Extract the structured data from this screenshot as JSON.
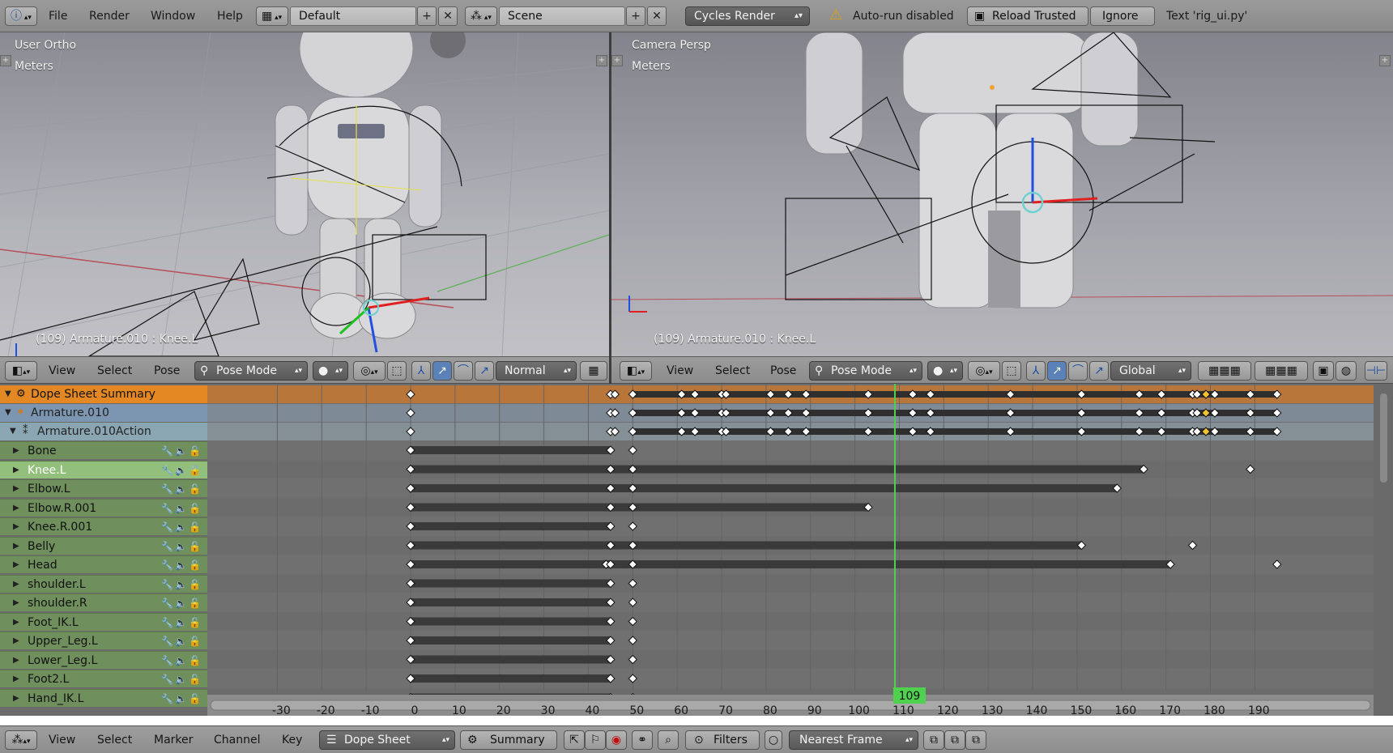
{
  "colors": {
    "summary_row": "#e38822",
    "object_row": "#7c95b1",
    "action_row": "#8aa6b3",
    "group_row": "#6f8f5c",
    "group_row_selected": "#92c07c",
    "playhead": "#4fd14f",
    "keyframe": "#ffffff",
    "keyframe_selected": "#f5c42c"
  },
  "topbar": {
    "info_icon": "info-icon",
    "menus": [
      "File",
      "Render",
      "Window",
      "Help"
    ],
    "layout_name": "Default",
    "scene_name": "Scene",
    "render_engine": "Cycles Render",
    "warning_text": "Auto-run disabled",
    "reload_label": "Reload Trusted",
    "ignore_label": "Ignore",
    "script_text": "Text 'rig_ui.py'"
  },
  "viewport_left": {
    "view_label": "User Ortho",
    "units_label": "Meters",
    "status": "(109) Armature.010 : Knee.L"
  },
  "viewport_right": {
    "view_label": "Camera Persp",
    "units_label": "Meters",
    "status": "(109) Armature.010 : Knee.L"
  },
  "viewport_header_left": {
    "menus": [
      "View",
      "Select",
      "Pose"
    ],
    "mode": "Pose Mode",
    "orientation": "Normal"
  },
  "viewport_header_right": {
    "menus": [
      "View",
      "Select",
      "Pose"
    ],
    "mode": "Pose Mode",
    "orientation": "Global"
  },
  "dopesheet": {
    "summary_label": "Dope Sheet Summary",
    "object_label": "Armature.010",
    "action_label": "Armature.010Action",
    "channels": [
      "Bone",
      "Knee.L",
      "Elbow.L",
      "Elbow.R.001",
      "Knee.R.001",
      "Belly",
      "Head",
      "shoulder.L",
      "shoulder.R",
      "Foot_IK.L",
      "Upper_Leg.L",
      "Lower_Leg.L",
      "Foot2.L",
      "Hand_IK.L"
    ],
    "selected_channel": "Knee.L",
    "current_frame": "109",
    "frame_ticks": [
      "-30",
      "-20",
      "-10",
      "0",
      "10",
      "20",
      "30",
      "40",
      "50",
      "60",
      "70",
      "80",
      "90",
      "100",
      "110",
      "120",
      "130",
      "140",
      "150",
      "160",
      "170",
      "180",
      "190"
    ],
    "summary_keys": [
      0,
      45,
      46,
      50,
      61,
      64,
      70,
      71,
      81,
      85,
      89,
      103,
      113,
      117,
      135,
      151,
      164,
      169,
      176,
      177,
      179,
      181,
      189,
      195
    ],
    "summary_selected_keys": [
      179
    ],
    "channel_keys": [
      [
        0,
        45,
        50
      ],
      [
        0,
        45,
        50,
        165,
        189
      ],
      [
        0,
        45,
        50,
        159
      ],
      [
        0,
        45,
        50,
        103
      ],
      [
        0,
        45,
        50
      ],
      [
        0,
        45,
        50,
        151,
        176
      ],
      [
        0,
        44,
        45,
        50,
        171,
        195
      ],
      [
        0,
        45,
        50
      ],
      [
        0,
        45,
        50
      ],
      [
        0,
        45,
        50
      ],
      [
        0,
        45,
        50
      ],
      [
        0,
        45,
        50
      ],
      [
        0,
        45,
        50
      ],
      [
        0,
        45,
        50
      ]
    ],
    "channel_holds": [
      [
        [
          0,
          45
        ]
      ],
      [
        [
          0,
          165
        ]
      ],
      [
        [
          0,
          159
        ]
      ],
      [
        [
          0,
          103
        ]
      ],
      [
        [
          0,
          45
        ]
      ],
      [
        [
          0,
          151
        ]
      ],
      [
        [
          0,
          171
        ]
      ],
      [
        [
          0,
          45
        ]
      ],
      [
        [
          0,
          45
        ]
      ],
      [
        [
          0,
          45
        ]
      ],
      [
        [
          0,
          45
        ]
      ],
      [
        [
          0,
          45
        ]
      ],
      [
        [
          0,
          45
        ]
      ],
      [
        [
          0,
          45
        ]
      ]
    ]
  },
  "bottombar": {
    "menus": [
      "View",
      "Select",
      "Marker",
      "Channel",
      "Key"
    ],
    "editor_mode": "Dope Sheet",
    "summary_toggle": "Summary",
    "filters_label": "Filters",
    "snap_mode": "Nearest Frame"
  }
}
